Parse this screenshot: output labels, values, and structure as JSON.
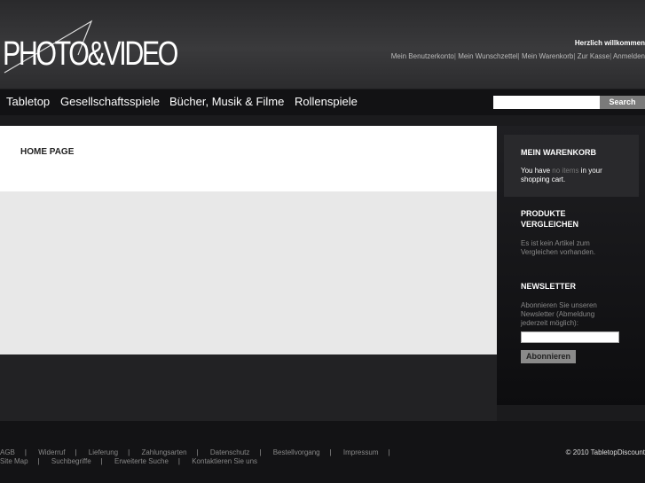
{
  "header": {
    "logo": "PHOTO&VIDEO",
    "welcome": "Herzlich willkommen",
    "links": [
      "Mein Benutzerkonto",
      "Mein Wunschzettel",
      "Mein Warenkorb",
      "Zur Kasse",
      "Anmelden"
    ]
  },
  "nav": {
    "items": [
      "Tabletop",
      "Gesellschaftsspiele",
      "Bücher, Musik & Filme",
      "Rollenspiele"
    ],
    "search_value": "",
    "search_label": "Search"
  },
  "main": {
    "title": "HOME PAGE"
  },
  "sidebar": {
    "cart": {
      "title": "MEIN WARENKORB",
      "text_before": "You have ",
      "highlight": "no items",
      "text_after": " in your shopping cart.",
      "highlight_color": "#777777"
    },
    "compare": {
      "title": "PRODUKTE VERGLEICHEN",
      "text": "Es ist kein Artikel zum Vergleichen vorhanden."
    },
    "newsletter": {
      "title": "NEWSLETTER",
      "text": "Abonnieren Sie unseren Newsletter (Abmeldung jederzeit möglich):",
      "input_value": "",
      "button": "Abonnieren"
    }
  },
  "footer": {
    "row1": [
      "AGB",
      "Widerruf",
      "Lieferung",
      "Zahlungsarten",
      "Datenschutz",
      "Bestellvorgang",
      "Impressum"
    ],
    "row2": [
      "Site Map",
      "Suchbegriffe",
      "Erweiterte Suche",
      "Kontaktieren Sie uns"
    ],
    "copyright": "© 2010 TabletopDiscount"
  }
}
